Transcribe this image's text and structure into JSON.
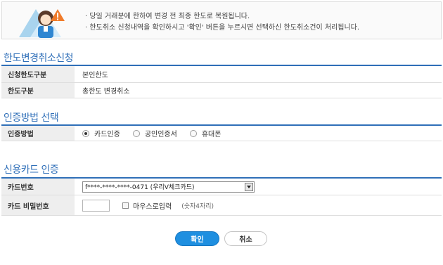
{
  "notice": {
    "lines": [
      "· 당일 거래분에 한하여 변경 전 최종 한도로 복원됩니다.",
      "· 한도취소 신청내역을 확인하시고 '확인' 버튼을 누르시면 선택하신 한도취소건이 처리됩니다."
    ]
  },
  "limit_section": {
    "title": "한도변경취소신청",
    "rows": [
      {
        "label": "신청한도구분",
        "value": "본인한도"
      },
      {
        "label": "한도구분",
        "value": "총한도 변경취소"
      }
    ]
  },
  "auth_section": {
    "title": "인증방법 선택",
    "label": "인증방법",
    "options": [
      {
        "label": "카드인증",
        "checked": true
      },
      {
        "label": "공인인증서",
        "checked": false
      },
      {
        "label": "휴대폰",
        "checked": false
      }
    ]
  },
  "card_section": {
    "title": "신용카드 인증",
    "card_label": "카드번호",
    "card_selected": "f****-****-****-0471 (우리V체크카드)",
    "password_label": "카드 비밀번호",
    "mouse_input_label": "마우스로입력",
    "password_hint": "(숫자4자리)"
  },
  "buttons": {
    "confirm": "확인",
    "cancel": "취소"
  },
  "colors": {
    "accent": "#2f6fb8",
    "confirm_button": "#1f8fe0"
  }
}
